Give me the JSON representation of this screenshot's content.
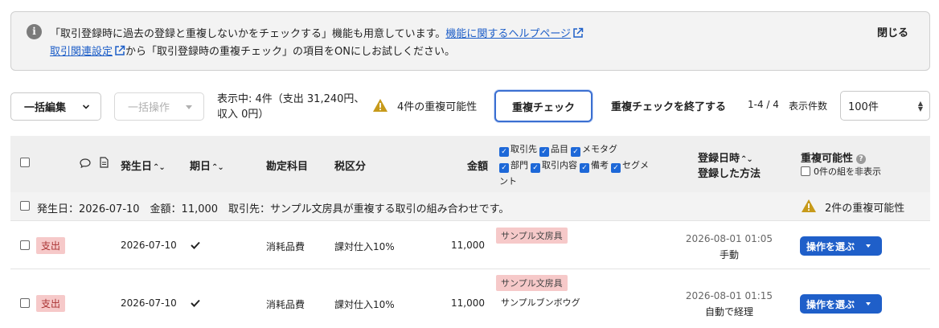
{
  "banner": {
    "text1": "「取引登録時に過去の登録と重複しないかをチェックする」機能も用意しています。",
    "link1": "機能に関するヘルプページ",
    "link2": "取引関連設定",
    "text2": "から「取引登録時の重複チェック」の項目をONにしお試しください。",
    "close": "閉じる"
  },
  "toolbar": {
    "bulk_edit": "一括編集",
    "bulk_op": "一括操作",
    "summary_line1": "表示中: 4件（支出 31,240円、",
    "summary_line2": "収入 0円）",
    "dup_possibility": "4件の重複可能性",
    "dup_check": "重複チェック",
    "end_dup_check": "重複チェックを終了する",
    "range": "1-4 / 4",
    "per_page_label": "表示件数",
    "per_page_value": "100件"
  },
  "table": {
    "headers": {
      "issue_date": "発生日",
      "due_date": "期日",
      "account": "勘定科目",
      "tax": "税区分",
      "amount": "金額",
      "registered_line1": "登録日時",
      "registered_line2": "登録した方法",
      "dup_possibility": "重複可能性",
      "hide_zero": "0件の組を非表示"
    },
    "column_options": [
      "取引先",
      "品目",
      "メモタグ",
      "部門",
      "取引内容",
      "備考",
      "セグメ",
      "ント"
    ],
    "group": {
      "text": "発生日：2026-07-10　金額：11,000　取引先：サンプル文房具が重複する取引の組み合わせです。",
      "dup": "2件の重複可能性"
    },
    "rows": [
      {
        "type": "支出",
        "issue_date": "2026-07-10",
        "account": "消耗品費",
        "tax": "課対仕入10%",
        "amount": "11,000",
        "vendor": "サンプル文房具",
        "content": "",
        "registered_at": "2026-08-01 01:05",
        "method": "手動",
        "action": "操作を選ぶ"
      },
      {
        "type": "支出",
        "issue_date": "2026-07-10",
        "account": "消耗品費",
        "tax": "課対仕入10%",
        "amount": "11,000",
        "vendor": "サンプル文房具",
        "content": "サンプルブンボウグ",
        "registered_at": "2026-08-01 01:15",
        "method": "自動で経理",
        "action": "操作を選ぶ"
      }
    ]
  },
  "colors": {
    "accent": "#1f5fc9",
    "expense_tag": "#f6c9c9",
    "warning": "#c79a1a"
  }
}
